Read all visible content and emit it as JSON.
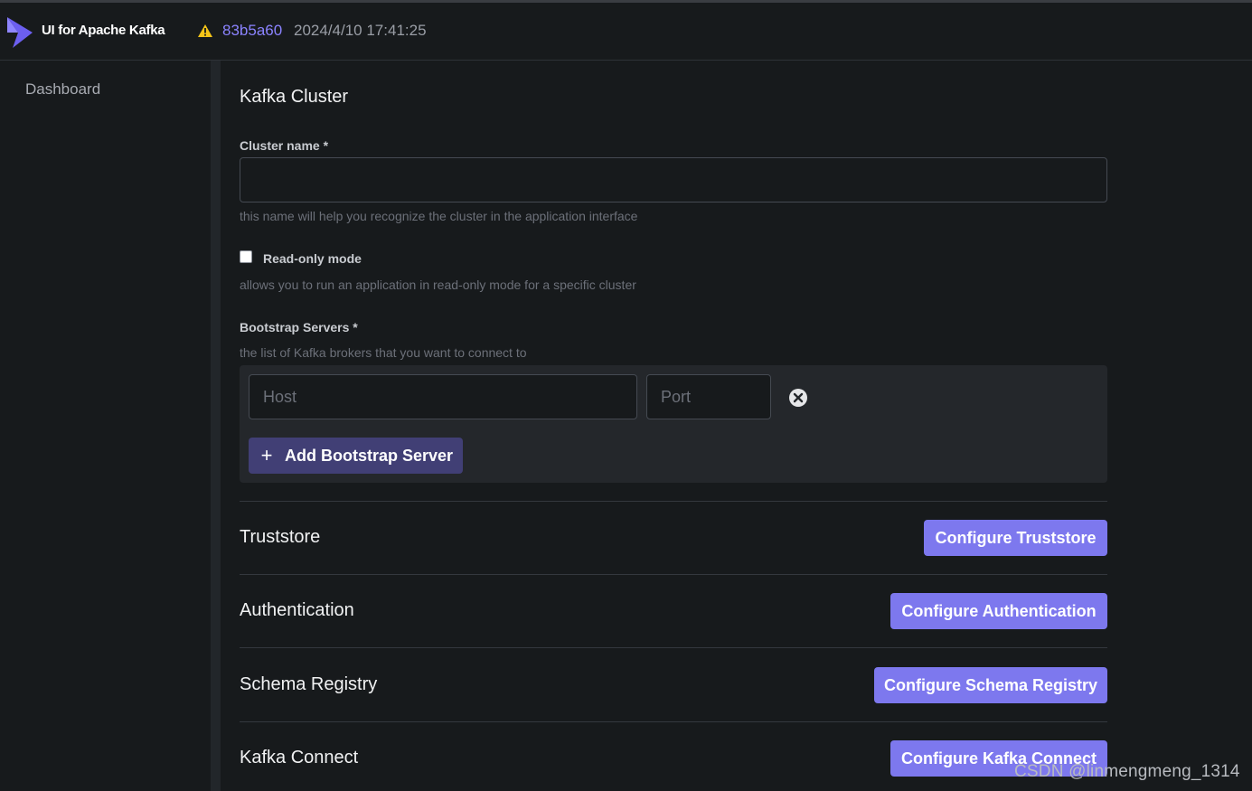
{
  "header": {
    "app_title": "UI for Apache Kafka",
    "commit_hash": "83b5a60",
    "build_date": "2024/4/10 17:41:25",
    "warning_icon": "warning-triangle-icon",
    "colors": {
      "accent": "#7d78ee",
      "link": "#8b83ff",
      "warning": "#f5c518"
    }
  },
  "sidebar": {
    "items": [
      {
        "label": "Dashboard"
      }
    ]
  },
  "form": {
    "title": "Kafka Cluster",
    "cluster_name": {
      "label": "Cluster name *",
      "value": "",
      "hint": "this name will help you recognize the cluster in the application interface"
    },
    "readonly": {
      "label": "Read-only mode",
      "checked": false,
      "hint": "allows you to run an application in read-only mode for a specific cluster"
    },
    "bootstrap": {
      "label": "Bootstrap Servers *",
      "hint": "the list of Kafka brokers that you want to connect to",
      "host_placeholder": "Host",
      "port_placeholder": "Port",
      "add_label": "Add Bootstrap Server"
    },
    "sections": [
      {
        "title": "Truststore",
        "button": "Configure Truststore"
      },
      {
        "title": "Authentication",
        "button": "Configure Authentication"
      },
      {
        "title": "Schema Registry",
        "button": "Configure Schema Registry"
      },
      {
        "title": "Kafka Connect",
        "button": "Configure Kafka Connect"
      }
    ]
  },
  "watermark": "CSDN @linmengmeng_1314"
}
